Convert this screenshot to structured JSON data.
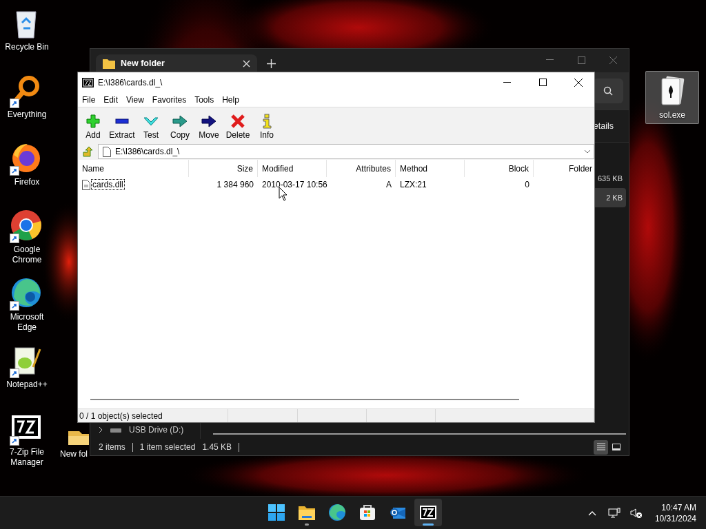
{
  "desktop": {
    "icons": [
      {
        "label": "Recycle Bin",
        "kind": "recycle",
        "shortcut": false
      },
      {
        "label": "Everything",
        "kind": "everything",
        "shortcut": true
      },
      {
        "label": "Firefox",
        "kind": "firefox",
        "shortcut": true
      },
      {
        "label": "Google Chrome",
        "kind": "chrome",
        "shortcut": true
      },
      {
        "label": "Microsoft Edge",
        "kind": "edge",
        "shortcut": true
      },
      {
        "label": "Notepad++",
        "kind": "notepad",
        "shortcut": true
      },
      {
        "label": "7-Zip File Manager",
        "kind": "sevenzip",
        "shortcut": true
      }
    ],
    "folder_icon": {
      "label": "New fol",
      "kind": "folder"
    },
    "right_icon": {
      "label": "sol.exe",
      "kind": "cards",
      "selected": true
    }
  },
  "explorer": {
    "tab": {
      "title": "New folder"
    },
    "command_text": "etails",
    "rows": [
      {
        "size": "635 KB",
        "selected": false
      },
      {
        "size": "2 KB",
        "selected": true
      }
    ],
    "nav_item": {
      "label": "USB Drive (D:)"
    },
    "status": {
      "count": "2 items",
      "selection": "1 item selected",
      "size": "1.45 KB"
    },
    "views": [
      {
        "kind": "details",
        "selected": true
      },
      {
        "kind": "tiles",
        "selected": false
      }
    ]
  },
  "sevenzip": {
    "title": "E:\\I386\\cards.dl_\\",
    "menu": [
      "File",
      "Edit",
      "View",
      "Favorites",
      "Tools",
      "Help"
    ],
    "toolbar": [
      {
        "label": "Add",
        "kind": "add"
      },
      {
        "label": "Extract",
        "kind": "extract"
      },
      {
        "label": "Test",
        "kind": "test"
      },
      {
        "label": "Copy",
        "kind": "copy"
      },
      {
        "label": "Move",
        "kind": "move"
      },
      {
        "label": "Delete",
        "kind": "delete"
      },
      {
        "label": "Info",
        "kind": "info"
      }
    ],
    "address": "E:\\I386\\cards.dl_\\",
    "columns": [
      "Name",
      "Size",
      "Modified",
      "Attributes",
      "Method",
      "Block",
      "Folder"
    ],
    "rows": [
      {
        "focused": true,
        "cells": [
          "cards.dll",
          "1 384 960",
          "2010-03-17 10:56",
          "A",
          "LZX:21",
          "0"
        ]
      }
    ],
    "status": "0 / 1 object(s) selected"
  },
  "taskbar": {
    "apps": [
      {
        "kind": "start",
        "active": false,
        "running": false
      },
      {
        "kind": "explorer",
        "active": false,
        "running": true
      },
      {
        "kind": "edge",
        "active": false,
        "running": false
      },
      {
        "kind": "store",
        "active": false,
        "running": false
      },
      {
        "kind": "outlook",
        "active": false,
        "running": false
      },
      {
        "kind": "sevenzip",
        "active": true,
        "running": true
      }
    ],
    "time": "10:47 AM",
    "date": "10/31/2024"
  }
}
